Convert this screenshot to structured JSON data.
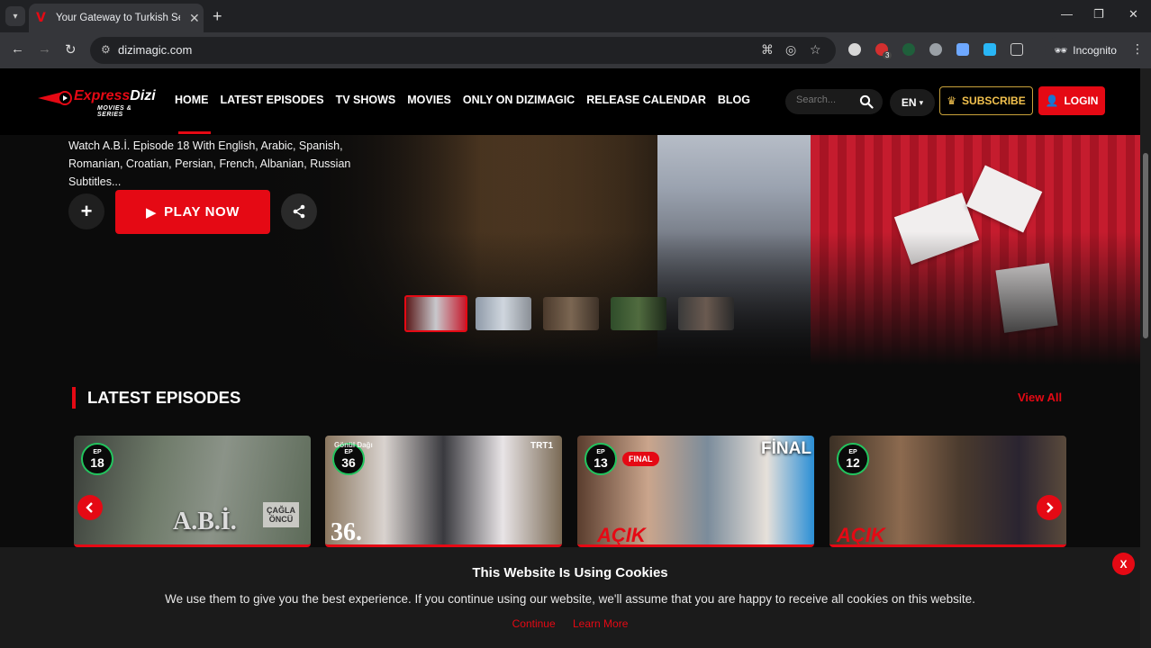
{
  "browser": {
    "tab_title": "Your Gateway to Turkish Series",
    "url": "dizimagic.com",
    "incognito_label": "Incognito",
    "extension_badge": "3"
  },
  "header": {
    "logo_word1": "Express",
    "logo_word2": "Dizi",
    "logo_tagline": "MOVIES & SERIES",
    "nav": [
      "HOME",
      "LATEST EPISODES",
      "TV SHOWS",
      "MOVIES",
      "ONLY ON DIZIMAGIC",
      "RELEASE CALENDAR",
      "BLOG"
    ],
    "search_placeholder": "Search...",
    "language": "EN",
    "subscribe_label": "SUBSCRIBE",
    "login_label": "LOGIN"
  },
  "hero": {
    "description": "Watch A.B.İ. Episode 18 With English, Arabic, Spanish, Romanian, Croatian, Persian, French, Albanian, Russian Subtitles...",
    "play_label": "PLAY NOW"
  },
  "latest": {
    "title": "LATEST EPISODES",
    "view_all": "View All",
    "cards": [
      {
        "ep_label": "EP",
        "ep_number": "18",
        "overlay": "A.B.İ.",
        "stone_text": "ÇAĞLA ÖNCÜ"
      },
      {
        "ep_label": "EP",
        "ep_number": "36",
        "overlay": "36.",
        "corner": "TRT1",
        "top_text": "Gönül Dağı"
      },
      {
        "ep_label": "EP",
        "ep_number": "13",
        "badge": "FINAL",
        "corner": "FİNAL",
        "overlay": "AÇIK"
      },
      {
        "ep_label": "EP",
        "ep_number": "12",
        "overlay": "AÇIK"
      }
    ]
  },
  "cookie": {
    "title": "This Website Is Using Cookies",
    "message": "We use them to give you the best experience. If you continue using our website, we'll assume that you are happy to receive all cookies on this website.",
    "continue": "Continue",
    "learn_more": "Learn More",
    "close": "X"
  },
  "colors": {
    "accent": "#e50914",
    "gold": "#f2c14e",
    "ep_ring": "#22c55e"
  }
}
